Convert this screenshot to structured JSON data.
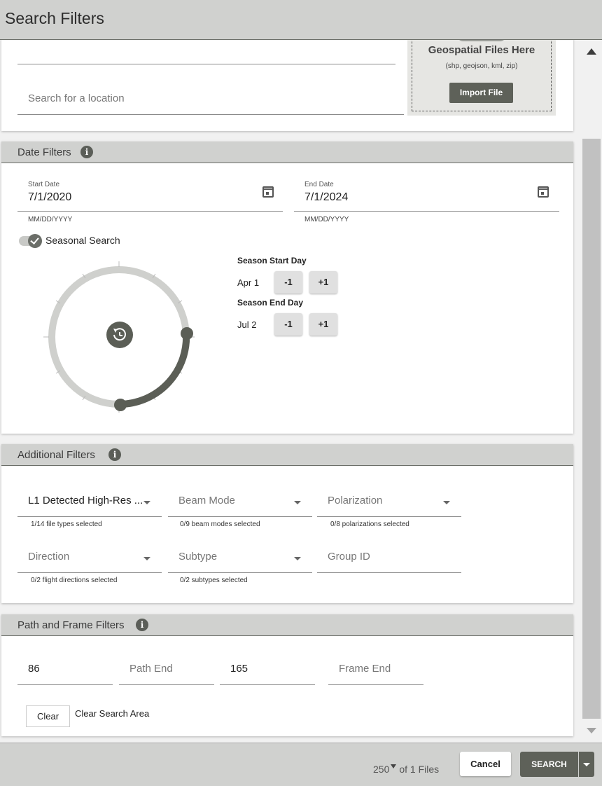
{
  "window": {
    "title": "Search Filters"
  },
  "geo": {
    "search_placeholder": "Search for a location",
    "drop_title": "Geospatial Files Here",
    "drop_formats": "(shp, geojson, kml, zip)",
    "import_label": "Import File"
  },
  "date_filters": {
    "header": "Date Filters",
    "start_label": "Start Date",
    "start_value": "7/1/2020",
    "end_label": "End Date",
    "end_value": "7/1/2024",
    "format_hint": "MM/DD/YYYY",
    "seasonal_label": "Seasonal Search",
    "seasonal_enabled": true,
    "season_start_title": "Season Start Day",
    "season_start_value": "Apr 1",
    "season_end_title": "Season End Day",
    "season_end_value": "Jul 2",
    "minus_label": "-1",
    "plus_label": "+1"
  },
  "additional_filters": {
    "header": "Additional Filters",
    "file_type_value": "L1 Detected High-Res ...",
    "file_type_hint": "1/14 file types selected",
    "beam_mode_placeholder": "Beam Mode",
    "beam_mode_hint": "0/9 beam modes selected",
    "polarization_placeholder": "Polarization",
    "polarization_hint": "0/8 polarizations selected",
    "direction_placeholder": "Direction",
    "direction_hint": "0/2 flight directions selected",
    "subtype_placeholder": "Subtype",
    "subtype_hint": "0/2 subtypes selected",
    "group_id_placeholder": "Group ID"
  },
  "path_frame": {
    "header": "Path and Frame Filters",
    "path_start_value": "86",
    "path_end_placeholder": "Path End",
    "frame_start_value": "165",
    "frame_end_placeholder": "Frame End",
    "clear_label": "Clear",
    "clear_area_label": "Clear Search Area"
  },
  "footer": {
    "max_results": "250",
    "files_text": "of 1 Files",
    "cancel_label": "Cancel",
    "search_label": "SEARCH"
  },
  "colors": {
    "header_bg": "#d0d1cf",
    "accent": "#5e6159",
    "dial_track": "#cfd0cd",
    "dial_range": "#5b5e56"
  }
}
